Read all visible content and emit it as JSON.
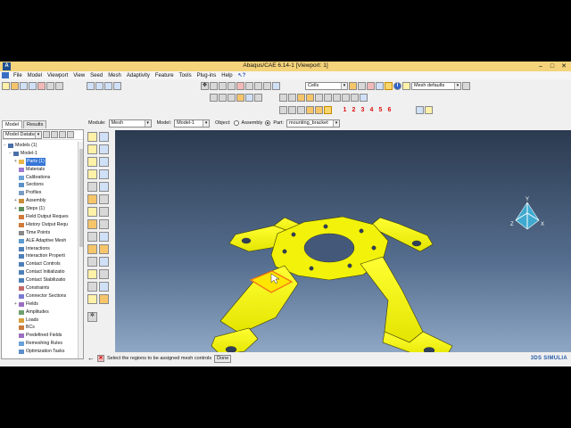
{
  "window": {
    "title": "Abaqus/CAE 6.14-1 [Viewport: 1]"
  },
  "menu": [
    "File",
    "Model",
    "Viewport",
    "View",
    "Seed",
    "Mesh",
    "Adaptivity",
    "Feature",
    "Tools",
    "Plug-ins",
    "Help"
  ],
  "toolbar": {
    "selection_filter": "Cells",
    "mesh_defaults": "Mesh defaults",
    "numbers": [
      "1",
      "2",
      "3",
      "4",
      "5",
      "6"
    ]
  },
  "context": {
    "module_label": "Module:",
    "module_value": "Mesh",
    "model_label": "Model:",
    "model_value": "Model-1",
    "object_label": "Object:",
    "assembly_label": "Assembly",
    "part_label": "Part:",
    "part_value": "mounting_bracket"
  },
  "tabs": [
    "Model",
    "Results"
  ],
  "tree_header": {
    "combo": "Model Databa"
  },
  "tree": [
    {
      "label": "Models (1)",
      "indent": 0,
      "tog": "−",
      "icon": "#4a6fa8"
    },
    {
      "label": "Model-1",
      "indent": 1,
      "tog": "−",
      "icon": "#4a6fa8"
    },
    {
      "label": "Parts (1)",
      "indent": 2,
      "tog": "+",
      "icon": "#e8b84a",
      "hl": true
    },
    {
      "label": "Materials",
      "indent": 2,
      "tog": "",
      "icon": "#9b7ad1"
    },
    {
      "label": "Calibrations",
      "indent": 2,
      "tog": "",
      "icon": "#6aa1d8"
    },
    {
      "label": "Sections",
      "indent": 2,
      "tog": "",
      "icon": "#5c8fc9"
    },
    {
      "label": "Profiles",
      "indent": 2,
      "tog": "",
      "icon": "#7a9cc4"
    },
    {
      "label": "Assembly",
      "indent": 2,
      "tog": "+",
      "icon": "#c98e3c"
    },
    {
      "label": "Steps (1)",
      "indent": 2,
      "tog": "+",
      "icon": "#5e8f5e"
    },
    {
      "label": "Field Output Reques",
      "indent": 2,
      "tog": "",
      "icon": "#d07a3a"
    },
    {
      "label": "History Output Requ",
      "indent": 2,
      "tog": "",
      "icon": "#d07a3a"
    },
    {
      "label": "Time Points",
      "indent": 2,
      "tog": "",
      "icon": "#888888"
    },
    {
      "label": "ALE Adaptive Mesh",
      "indent": 2,
      "tog": "",
      "icon": "#5e9bd1"
    },
    {
      "label": "Interactions",
      "indent": 2,
      "tog": "",
      "icon": "#4e7fb8"
    },
    {
      "label": "Interaction Properti",
      "indent": 2,
      "tog": "",
      "icon": "#4e7fb8"
    },
    {
      "label": "Contact Controls",
      "indent": 2,
      "tog": "",
      "icon": "#4e7fb8"
    },
    {
      "label": "Contact Initializatio",
      "indent": 2,
      "tog": "",
      "icon": "#4e7fb8"
    },
    {
      "label": "Contact Stabilizatio",
      "indent": 2,
      "tog": "",
      "icon": "#4e7fb8"
    },
    {
      "label": "Constraints",
      "indent": 2,
      "tog": "",
      "icon": "#c46a6a"
    },
    {
      "label": "Connector Sections",
      "indent": 2,
      "tog": "",
      "icon": "#7a7ad0"
    },
    {
      "label": "Fields",
      "indent": 2,
      "tog": "+",
      "icon": "#9a6fc0"
    },
    {
      "label": "Amplitudes",
      "indent": 2,
      "tog": "",
      "icon": "#6f9f6f"
    },
    {
      "label": "Loads",
      "indent": 2,
      "tog": "",
      "icon": "#d9a03b"
    },
    {
      "label": "BCs",
      "indent": 2,
      "tog": "",
      "icon": "#c97a3a"
    },
    {
      "label": "Predefined Fields",
      "indent": 2,
      "tog": "",
      "icon": "#9a6fc0"
    },
    {
      "label": "Remeshing Rules",
      "indent": 2,
      "tog": "",
      "icon": "#6aa1d8"
    },
    {
      "label": "Optimization Tasks",
      "indent": 2,
      "tog": "",
      "icon": "#5c8fc9"
    }
  ],
  "status": {
    "prompt": "Select the regions to be assigned mesh controls",
    "done": "Done"
  },
  "brand": "3DS SIMULIA",
  "triad": {
    "x": "X",
    "y": "Y",
    "z": "Z"
  },
  "colors": {
    "part": "#f2f20a",
    "selected_edge": "#f07a14",
    "title_bar": "#f4d37a"
  }
}
